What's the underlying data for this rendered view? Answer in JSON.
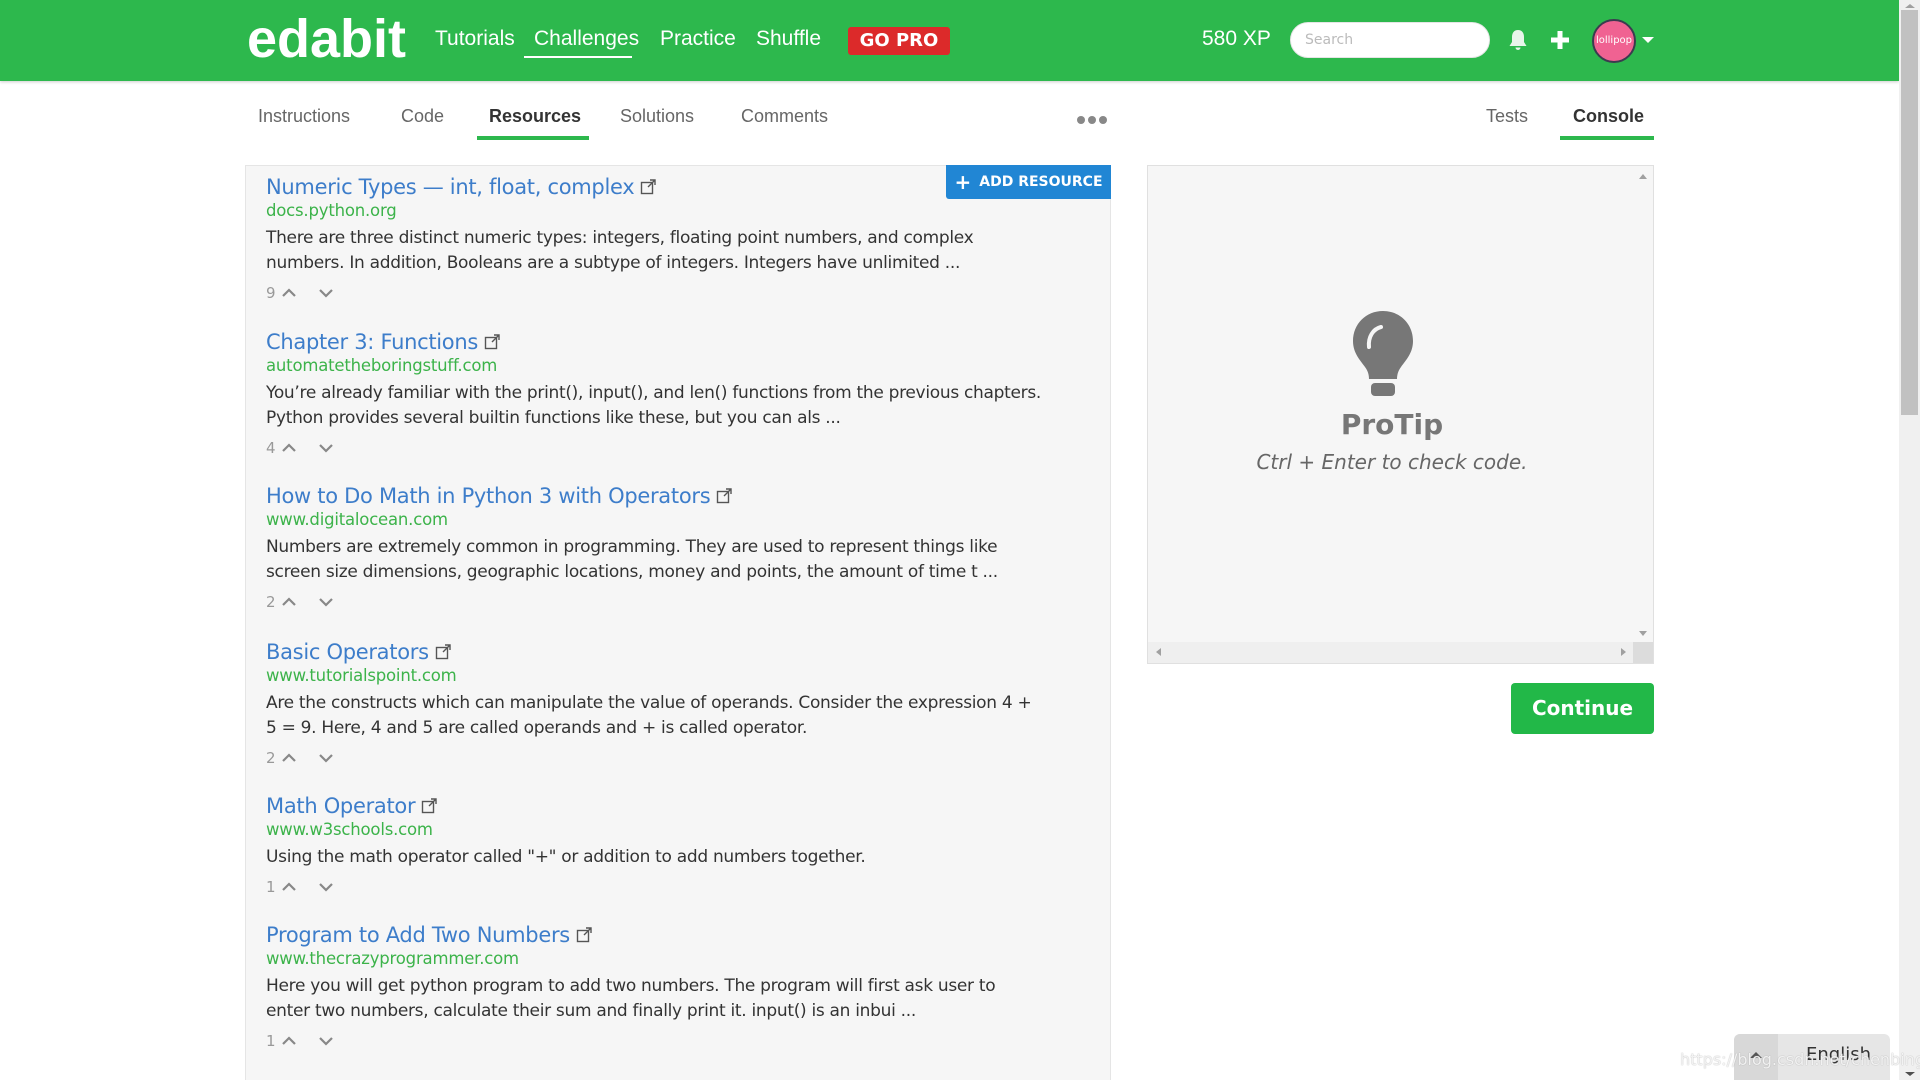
{
  "header": {
    "logo": "edabit",
    "nav": [
      {
        "label": "Tutorials"
      },
      {
        "label": "Challenges",
        "active": true
      },
      {
        "label": "Practice"
      },
      {
        "label": "Shuffle"
      }
    ],
    "go_pro": "GO PRO",
    "xp": "580 XP",
    "search_placeholder": "Search",
    "icons": {
      "notifications": "bell-icon",
      "create": "plus-icon",
      "menu": "caret-down-icon"
    },
    "avatar_text": "lollipop",
    "colors": {
      "brand": "#2db84d",
      "go_pro": "#dc2a2a"
    }
  },
  "tabs_left": [
    {
      "label": "Instructions"
    },
    {
      "label": "Code"
    },
    {
      "label": "Resources",
      "active": true
    },
    {
      "label": "Solutions"
    },
    {
      "label": "Comments"
    }
  ],
  "tabs_right": [
    {
      "label": "Tests"
    },
    {
      "label": "Console",
      "active": true
    }
  ],
  "more_icon": "more-horizontal-icon",
  "resources": {
    "add_button": "ADD RESOURCE",
    "items": [
      {
        "title": "Numeric Types — int, float, complex",
        "domain": "docs.python.org",
        "description_lines": [
          "There are three distinct numeric types: integers, floating point numbers, and complex",
          "numbers. In addition, Booleans are a subtype of integers. Integers have unlimited ..."
        ],
        "votes": "9"
      },
      {
        "title": "Chapter 3: Functions",
        "domain": "automatetheboringstuff.com",
        "description_lines": [
          "You’re already familiar with the print(), input(), and len() functions from the previous chapters.",
          "Python provides several builtin functions like these, but you can als ..."
        ],
        "votes": "4"
      },
      {
        "title": "How to Do Math in Python 3 with Operators",
        "domain": "www.digitalocean.com",
        "description_lines": [
          "Numbers are extremely common in programming. They are used to represent things like",
          "screen size dimensions, geographic locations, money and points, the amount of time t ..."
        ],
        "votes": "2"
      },
      {
        "title": "Basic Operators",
        "domain": "www.tutorialspoint.com",
        "description_lines": [
          "Are the constructs which can manipulate the value of operands. Consider the expression 4 +",
          "5 = 9. Here, 4 and 5 are called operands and + is called operator."
        ],
        "votes": "2"
      },
      {
        "title": "Math Operator",
        "domain": "www.w3schools.com",
        "description_lines": [
          "Using the math operator called \"+\" or addition to add numbers together."
        ],
        "votes": "1"
      },
      {
        "title": "Program to Add Two Numbers",
        "domain": "www.thecrazyprogrammer.com",
        "description_lines": [
          "Here you will get python program to add two numbers. The program will first ask user to",
          "enter two numbers, calculate their sum and finally print it. input() is an inbui ..."
        ],
        "votes": "1"
      }
    ]
  },
  "console": {
    "protip_title": "ProTip",
    "protip_text": "Ctrl + Enter to check code.",
    "icon": "lightbulb-icon"
  },
  "continue_button": "Continue",
  "language": "English",
  "watermark": "https://blog.csdn.net/chenbingcai"
}
